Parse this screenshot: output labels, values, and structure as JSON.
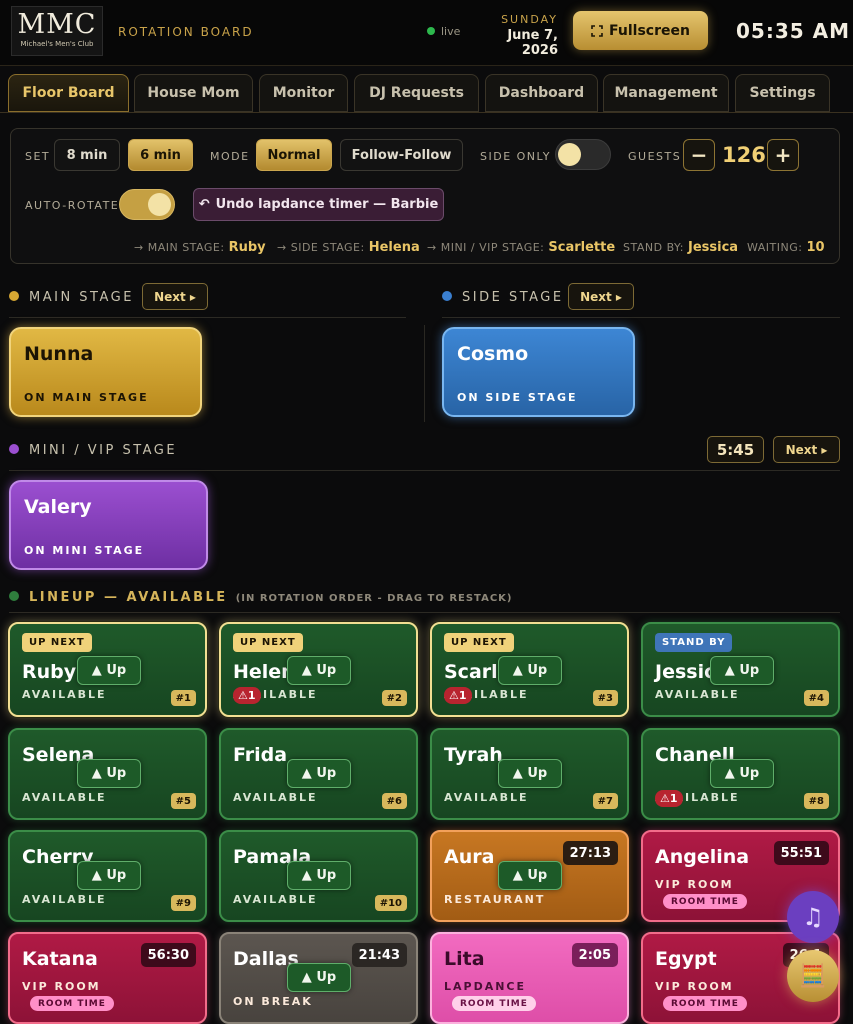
{
  "header": {
    "logo_big": "MMC",
    "logo_small": "Michael's Men's Club",
    "subtitle": "ROTATION BOARD",
    "live": "live",
    "day": "SUNDAY",
    "date": "June 7, 2026",
    "fullscreen": "Fullscreen",
    "clock": "05:35 AM"
  },
  "tabs": [
    "Floor Board",
    "House Mom",
    "Monitor",
    "DJ Requests",
    "Dashboard",
    "Management",
    "Settings"
  ],
  "controls": {
    "set_label": "SET",
    "set_options": [
      "8 min",
      "6 min"
    ],
    "set_selected": "6 min",
    "mode_label": "MODE",
    "mode_options": [
      "Normal",
      "Follow-Follow"
    ],
    "mode_selected": "Normal",
    "side_only_label": "SIDE ONLY",
    "side_only": false,
    "guests_label": "GUESTS",
    "guests_minus": "−",
    "guests_plus": "+",
    "guests": "126",
    "auto_rotate_label": "AUTO-ROTATE",
    "auto_rotate": true,
    "undo": "Undo lapdance timer — Barbie"
  },
  "summary": {
    "main_label": "→ MAIN STAGE:",
    "main": "Ruby",
    "side_label": "→ SIDE STAGE:",
    "side": "Helena",
    "mini_label": "→ MINI / VIP STAGE:",
    "mini": "Scarlette",
    "standby_label": "STAND BY:",
    "standby": "Jessica",
    "waiting_label": "WAITING:",
    "waiting": "10"
  },
  "stages": {
    "main": {
      "title": "MAIN STAGE",
      "next": "Next ▸",
      "dancer": "Nunna",
      "status": "ON MAIN STAGE",
      "color": "#d6a733"
    },
    "side": {
      "title": "SIDE STAGE",
      "next": "Next ▸",
      "dancer": "Cosmo",
      "status": "ON SIDE STAGE",
      "color": "#3a7fd0"
    },
    "mini": {
      "title": "MINI / VIP STAGE",
      "next": "Next ▸",
      "timer": "5:45",
      "dancer": "Valery",
      "status": "ON MINI STAGE",
      "color": "#9b4fd0"
    }
  },
  "lineup": {
    "title": "LINEUP — AVAILABLE",
    "subtitle": "(IN ROTATION ORDER - DRAG TO RESTACK)",
    "up_label": "▲ Up",
    "cards": [
      {
        "name": "Ruby",
        "status": "AVAILABLE",
        "badge": "UP NEXT",
        "num": "#1"
      },
      {
        "name": "Helena",
        "status": "AVAILABLE",
        "badge": "UP NEXT",
        "warn": "⚠1",
        "num": "#2"
      },
      {
        "name": "Scarlette",
        "status": "AVAILABLE",
        "badge": "UP NEXT",
        "warn": "⚠1",
        "num": "#3"
      },
      {
        "name": "Jessica",
        "status": "AVAILABLE",
        "badge": "STAND BY",
        "num": "#4"
      },
      {
        "name": "Selena",
        "status": "AVAILABLE",
        "num": "#5"
      },
      {
        "name": "Frida",
        "status": "AVAILABLE",
        "num": "#6"
      },
      {
        "name": "Tyrah",
        "status": "AVAILABLE",
        "num": "#7"
      },
      {
        "name": "Chanell",
        "status": "AVAILABLE",
        "warn": "⚠1",
        "num": "#8"
      },
      {
        "name": "Cherry",
        "status": "AVAILABLE",
        "num": "#9"
      },
      {
        "name": "Pamala",
        "status": "AVAILABLE",
        "num": "#10"
      },
      {
        "name": "Aura",
        "status": "RESTAURANT",
        "timer": "27:13"
      },
      {
        "name": "Angelina",
        "status": "VIP ROOM",
        "timer": "55:51",
        "tag": "ROOM TIME"
      },
      {
        "name": "Katana",
        "status": "VIP ROOM",
        "timer": "56:30",
        "tag": "ROOM TIME"
      },
      {
        "name": "Dallas",
        "status": "ON BREAK",
        "timer": "21:43"
      },
      {
        "name": "Lita",
        "status": "LAPDANCE",
        "timer": "2:05",
        "tag": "ROOM TIME"
      },
      {
        "name": "Egypt",
        "status": "VIP ROOM",
        "timer": "26:1",
        "tag": "ROOM TIME"
      }
    ]
  },
  "fab": {
    "music": "music-icon",
    "cash": "register-icon"
  }
}
